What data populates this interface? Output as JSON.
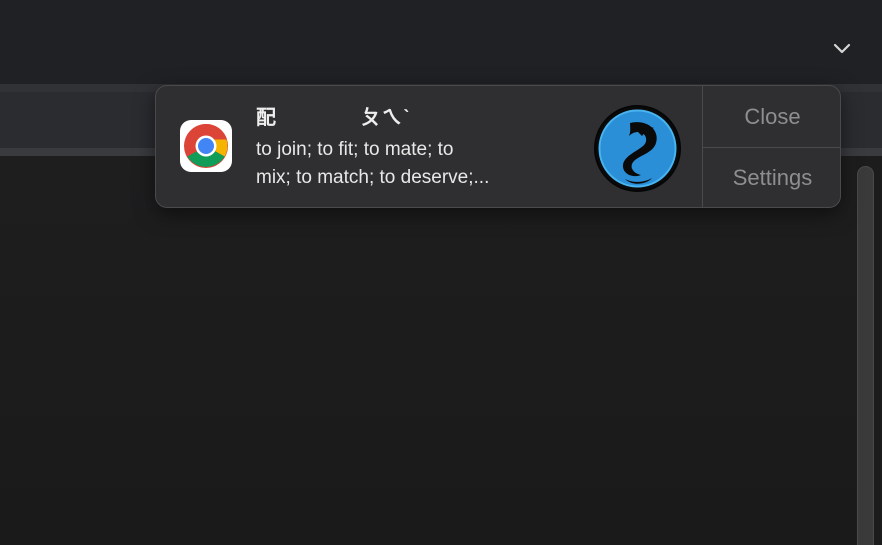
{
  "window": {
    "tab_overflow_icon": "chevron-down-icon"
  },
  "notification": {
    "app_icon": "chrome-icon",
    "title": "配\t\tㄆㄟˋ",
    "body_line1": "to join;  to fit;  to mate;  to",
    "body_line2": "mix;  to match;  to deserve;...",
    "content_image": "dragon-logo",
    "close_label": "Close",
    "settings_label": "Settings"
  },
  "colors": {
    "notification_bg": "#2f2f31",
    "action_text": "#8e8e90",
    "logo_blue": "#2a8fd6"
  }
}
